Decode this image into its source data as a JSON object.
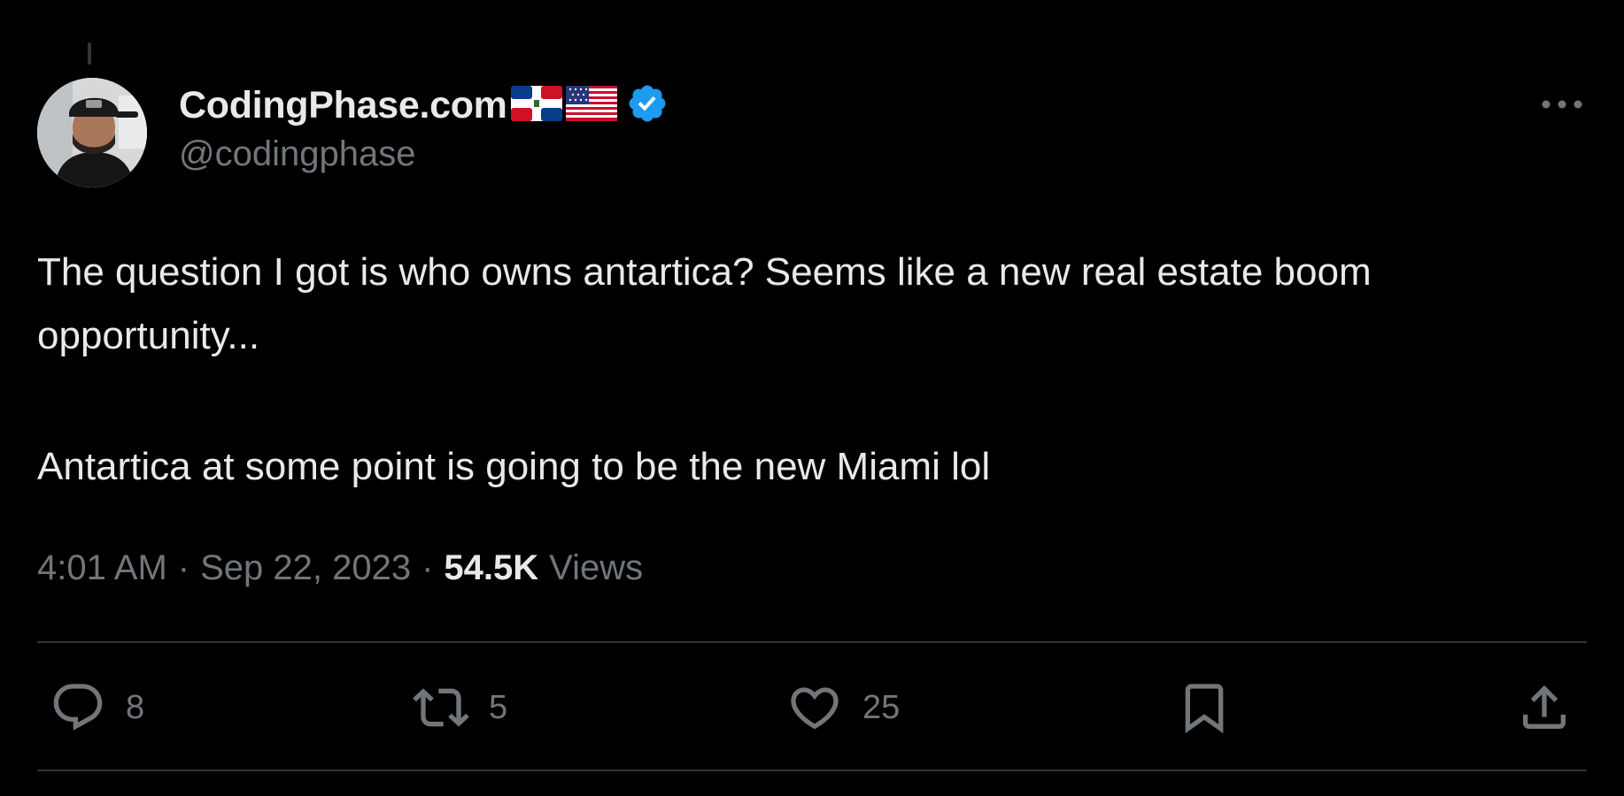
{
  "author": {
    "display_name": "CodingPhase.com",
    "flags": [
      "dominican-republic-flag",
      "united-states-flag"
    ],
    "verified": true,
    "handle": "@codingphase"
  },
  "tweet": {
    "paragraph_1": "The question I got is who owns antartica? Seems like a new real estate boom opportunity...",
    "paragraph_2": "Antartica at some point is going to be the new Miami lol"
  },
  "meta": {
    "time": "4:01 AM",
    "separator": "·",
    "date": "Sep 22, 2023",
    "views_count": "54.5K",
    "views_label": "Views"
  },
  "actions": {
    "reply_count": "8",
    "retweet_count": "5",
    "like_count": "25"
  },
  "colors": {
    "background": "#000000",
    "primary_text": "#e7e9ea",
    "secondary_text": "#71767b",
    "verified_badge": "#1d9bf0",
    "divider": "#2f3336"
  }
}
